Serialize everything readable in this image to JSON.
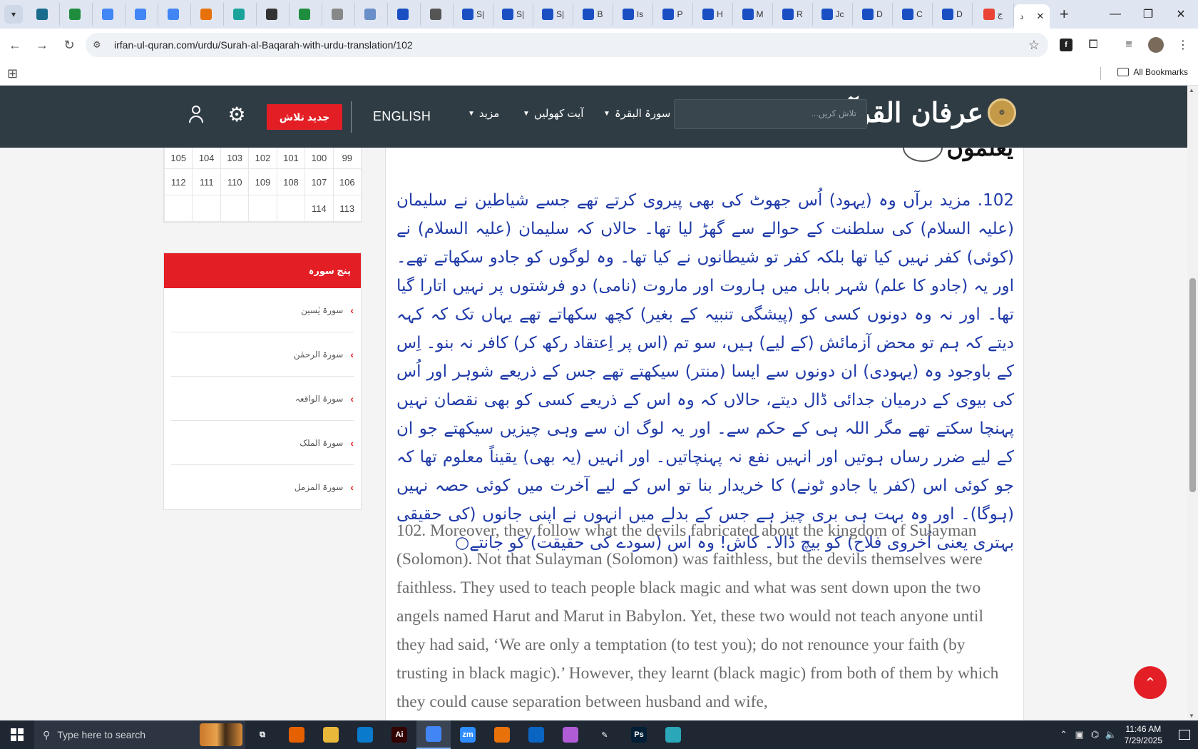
{
  "browser": {
    "tabs": [
      {
        "icon": "wordpress-icon",
        "color": "#1a6c8c",
        "label": ""
      },
      {
        "icon": "sheets-icon",
        "color": "#1e8e3e",
        "label": ""
      },
      {
        "icon": "docs-icon",
        "color": "#4285f4",
        "label": ""
      },
      {
        "icon": "docs-icon",
        "color": "#4285f4",
        "label": ""
      },
      {
        "icon": "docs-icon",
        "color": "#4285f4",
        "label": ""
      },
      {
        "icon": "puzzle-icon",
        "color": "#e8710a",
        "label": ""
      },
      {
        "icon": "circle-icon",
        "color": "#1aa39a",
        "label": ""
      },
      {
        "icon": "chatgpt-icon",
        "color": "#333333",
        "label": ""
      },
      {
        "icon": "sheets-icon",
        "color": "#1e8e3e",
        "label": ""
      },
      {
        "icon": "globe-icon",
        "color": "#888888",
        "label": ""
      },
      {
        "icon": "grid-icon",
        "color": "#6a8ec9",
        "label": ""
      },
      {
        "icon": "docs-blue-icon",
        "color": "#1a4fc4",
        "label": ""
      },
      {
        "icon": "speaker-icon",
        "color": "#555555",
        "label": ""
      },
      {
        "icon": "docs-blue-icon",
        "color": "#1a4fc4",
        "label": "S|"
      },
      {
        "icon": "docs-blue-icon",
        "color": "#1a4fc4",
        "label": "S|"
      },
      {
        "icon": "docs-blue-icon",
        "color": "#1a4fc4",
        "label": "S|"
      },
      {
        "icon": "docs-blue-icon",
        "color": "#1a4fc4",
        "label": "B"
      },
      {
        "icon": "docs-blue-icon",
        "color": "#1a4fc4",
        "label": "Is"
      },
      {
        "icon": "docs-blue-icon",
        "color": "#1a4fc4",
        "label": "P"
      },
      {
        "icon": "docs-blue-icon",
        "color": "#1a4fc4",
        "label": "H"
      },
      {
        "icon": "docs-blue-icon",
        "color": "#1a4fc4",
        "label": "M"
      },
      {
        "icon": "docs-blue-icon",
        "color": "#1a4fc4",
        "label": "R"
      },
      {
        "icon": "docs-blue-icon",
        "color": "#1a4fc4",
        "label": "Jc"
      },
      {
        "icon": "docs-blue-icon",
        "color": "#1a4fc4",
        "label": "D"
      },
      {
        "icon": "docs-blue-icon",
        "color": "#1a4fc4",
        "label": "C"
      },
      {
        "icon": "docs-blue-icon",
        "color": "#1a4fc4",
        "label": "D"
      },
      {
        "icon": "google-icon",
        "color": "#ea4335",
        "label": "ج"
      }
    ],
    "active_tab_label": "د",
    "url": "irfan-ul-quran.com/urdu/Surah-al-Baqarah-with-urdu-translation/102",
    "all_bookmarks": "All Bookmarks"
  },
  "site": {
    "logo_text": "عرفان القرآن",
    "search_placeholder": "تلاش کریں...",
    "nav": {
      "surah": "سورۃ البقرۃ",
      "ayat": "آیت کھولیں",
      "more": "مزید",
      "english": "ENGLISH",
      "new_search": "جدید تلاش"
    }
  },
  "ayah_grid": [
    [
      "99",
      "100",
      "101",
      "102",
      "103",
      "104",
      "105"
    ],
    [
      "106",
      "107",
      "108",
      "109",
      "110",
      "111",
      "112"
    ],
    [
      "113",
      "114",
      "",
      "",
      "",
      "",
      ""
    ]
  ],
  "panel": {
    "title": "پنج سورہ",
    "items": [
      "سورۃ یٰسین",
      "سورۃ الرحمٰن",
      "سورۃ الواقعہ",
      "سورۃ الملک",
      "سورۃ المزمل"
    ]
  },
  "main": {
    "ayah_head_word": "يَعْلَمُونَ",
    "urdu_text": "102. مزید برآں وہ (یہود) اُس جھوٹ کی بھی پیروی کرتے تھے جسے شیاطین نے سلیمان (علیہ السلام) کی سلطنت کے حوالے سے گھڑ لیا تھا۔ حالاں کہ سلیمان (علیہ السلام) نے (کوئی) کفر نہیں کیا تھا بلکہ کفر تو شیطانوں نے کیا تھا۔ وہ لوگوں کو جادو سکھاتے تھے۔ اور یہ (جادو کا علم) شہر بابل میں ہاروت اور ماروت (نامی) دو فرشتوں پر نہیں اتارا گیا تھا۔ اور نہ وہ دونوں کسی کو (پیشگی تنبیہ کے بغیر) کچھ سکھاتے تھے یہاں تک کہ کہہ دیتے کہ ہم تو محض آزمائش (کے لیے) ہیں، سو تم (اس پر اِعتقاد رکھ کر) کافر نہ بنو۔ اِس کے باوجود وہ (یہودی) ان دونوں سے ایسا (منتر) سیکھتے تھے جس کے ذریعے شوہر اور اُس کی بیوی کے درمیان جدائی ڈال دیتے، حالاں کہ وہ اس کے ذریعے کسی کو بھی نقصان نہیں پہنچا سکتے تھے مگر اللہ ہی کے حکم سے۔ اور یہ لوگ ان سے وہی چیزیں سیکھتے جو ان کے لیے ضرر رساں ہوتیں اور انہیں نفع نہ پہنچاتیں۔ اور انہیں (یہ بھی) یقیناً معلوم تھا کہ جو کوئی اس (کفر یا جادو ٹونے) کا خریدار بنا تو اس کے لیے آخرت میں کوئی حصہ نہیں (ہوگا)۔ اور وہ بہت ہی بری چیز ہے جس کے بدلے میں انہوں نے اپنی جانوں (کی حقیقی بہتری یعنی اُخروی فلاح) کو بیچ ڈالا۔ کاش! وہ اس (سودے کی حقیقت) کو جانتے○",
    "english_text": "102. Moreover, they follow what the devils fabricated about the kingdom of Sulayman (Solomon). Not that Sulayman (Solomon) was faithless, but the devils themselves were faithless. They used to teach people black magic and what was sent down upon the two angels named Harut and Marut in Babylon. Yet, these two would not teach anyone until they had said, ‘We are only a temptation (to test you); do not renounce your faith (by trusting in black magic).’ However, they learnt (black magic) from both of them by which they could cause separation between husband and wife,"
  },
  "taskbar": {
    "search_placeholder": "Type here to search",
    "apps": [
      {
        "name": "task-view-icon",
        "color": "#1f2733",
        "label": "⧉",
        "active": false
      },
      {
        "name": "firefox-icon",
        "color": "#e66000",
        "label": "",
        "active": false
      },
      {
        "name": "file-explorer-icon",
        "color": "#e8b83a",
        "label": "",
        "active": false
      },
      {
        "name": "vscode-icon",
        "color": "#0a7acc",
        "label": "",
        "active": false
      },
      {
        "name": "illustrator-icon",
        "color": "#330000",
        "label": "Ai",
        "active": false
      },
      {
        "name": "chrome-icon",
        "color": "#4285f4",
        "label": "",
        "active": true
      },
      {
        "name": "zoom-icon",
        "color": "#2d8cff",
        "label": "zm",
        "active": false
      },
      {
        "name": "puzzle-icon",
        "color": "#e8710a",
        "label": "",
        "active": false
      },
      {
        "name": "outlook-icon",
        "color": "#0a64c2",
        "label": "",
        "active": false
      },
      {
        "name": "paint-icon",
        "color": "#b05cd6",
        "label": "",
        "active": false
      },
      {
        "name": "pen-icon",
        "color": "#1f2733",
        "label": "✎",
        "active": false
      },
      {
        "name": "photoshop-icon",
        "color": "#001e36",
        "label": "Ps",
        "active": false
      },
      {
        "name": "diamond-app-icon",
        "color": "#2aa7b8",
        "label": "",
        "active": false
      }
    ],
    "time": "11:46 AM",
    "date": "7/29/2025"
  }
}
